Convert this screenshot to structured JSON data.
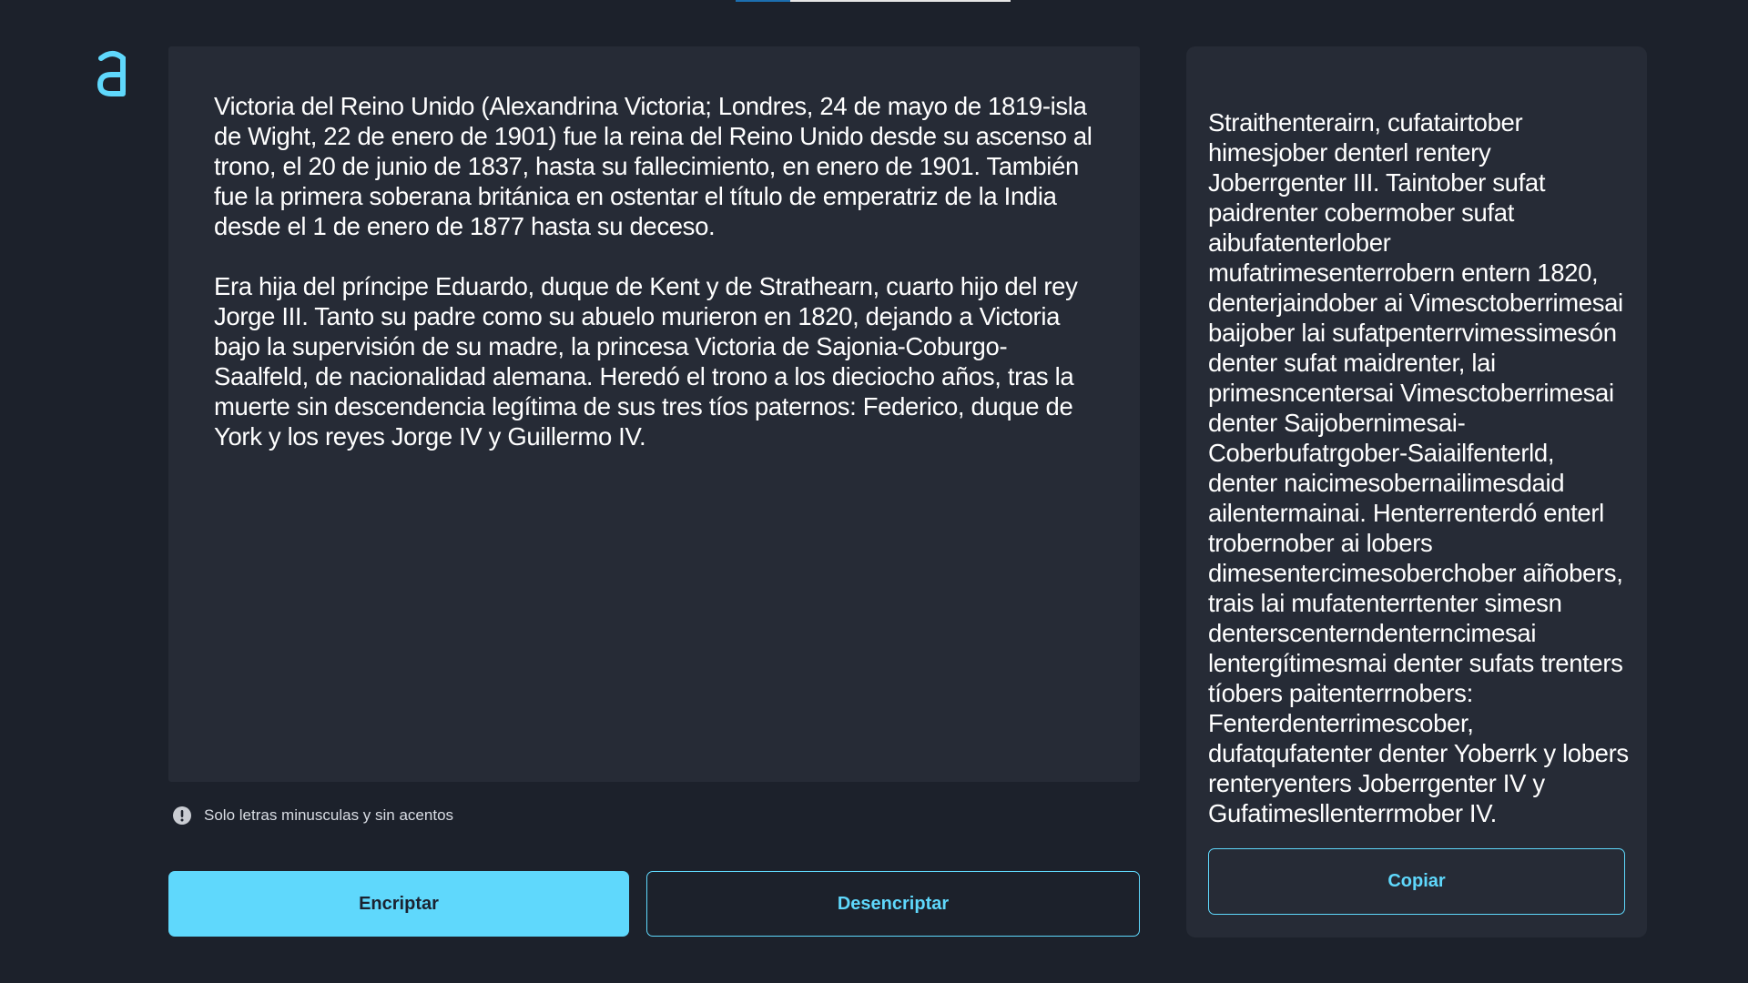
{
  "logo": {
    "icon": "alura-a-logo-icon",
    "color": "#5fd8fc"
  },
  "input": {
    "text": "Victoria del Reino Unido (Alexandrina Victoria; Londres, 24 de mayo de 1819-isla de Wight, 22 de enero de 1901) fue la reina del Reino Unido desde su ascenso al trono, el 20 de junio de 1837, hasta su fallecimiento, en enero de 1901. También fue la primera soberana británica en ostentar el título de emperatriz de la India desde el 1 de enero de 1877 hasta su deceso.\n\nEra hija del príncipe Eduardo, duque de Kent y de Strathearn, cuarto hijo del rey Jorge III. Tanto su padre como su abuelo murieron en 1820, dejando a Victoria bajo la supervisión de su madre, la princesa Victoria de Sajonia-Coburgo-Saalfeld, de nacionalidad alemana. Heredó el trono a los dieciocho años, tras la muerte sin descendencia legítima de sus tres tíos paternos: Federico, duque de York y los reyes Jorge IV y Guillermo IV."
  },
  "hint": {
    "icon": "info-exclamation-icon",
    "text": "Solo letras minusculas y sin acentos"
  },
  "buttons": {
    "encrypt": "Encriptar",
    "decrypt": "Desencriptar",
    "copy": "Copiar"
  },
  "output": {
    "text": "Straithenterairn, cufatairtober himesjober denterl rentery Joberrgenter III. Taintober sufat paidrenter cobermober sufat aibufatenterlober mufatrimesenterrobern entern 1820, denterjaindober ai Vimesctoberrimesai baijober lai sufatpenterrvimessimesón denter sufat maidrenter, lai primesncentersai Vimesctoberrimesai denter Saijobernimesai-Coberbufatrgober-Saiailfenterld, denter naicimesobernailimesdaid ailentermainai. Henterrenterdó enterl trobernober ai lobers dimesentercimesoberchober aiñobers, trais lai mufatenterrtenter simesn denterscenterndenterncimesai lentergítimesmai denter sufats trenters tíobers paitenterrnobers: Fenterdenterrimescober, dufatqufatenter denter Yoberrk y lobers renteryenters Joberrgenter IV y Gufatimesllenterrmober IV."
  },
  "colors": {
    "background": "#1c212b",
    "panel": "#262b36",
    "accent": "#5fd8fc"
  }
}
